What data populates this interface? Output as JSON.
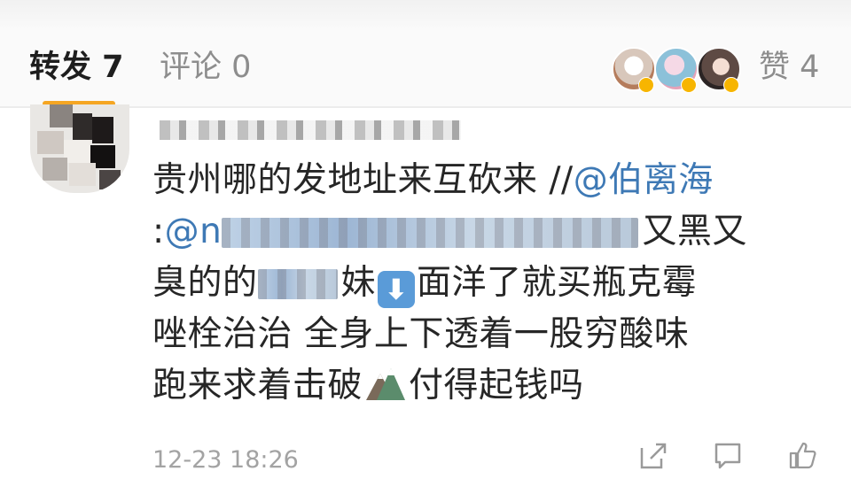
{
  "tabs": {
    "forward_label": "转发 7",
    "comment_label": "评论 0",
    "like_label": "赞 4"
  },
  "liker_avatars": [
    "avatar-1",
    "avatar-2",
    "avatar-3"
  ],
  "comment": {
    "text_lines": {
      "line1_a": "贵州哪的发地址来互砍来 //",
      "line1_mention": "@伯离海",
      "line2_a": ":",
      "line2_mention": "@n",
      "line2_b": "又黑又",
      "line3_a": "臭的的",
      "line3_b": "妹",
      "line3_emoji": "⬇",
      "line3_c": "面洋了就买瓶克霉",
      "line4": "唑栓治治 全身上下透着一股穷酸味",
      "line5_a": "跑来求着击破",
      "line5_b": "付得起钱吗"
    },
    "timestamp": "12-23 18:26"
  },
  "colors": {
    "accent": "#f5a623",
    "mention": "#3e79b5",
    "muted": "#8d8d8d"
  },
  "icons": [
    "share-icon",
    "comment-icon",
    "thumbs-up-icon",
    "mountain-emoji",
    "down-arrow-emoji"
  ]
}
